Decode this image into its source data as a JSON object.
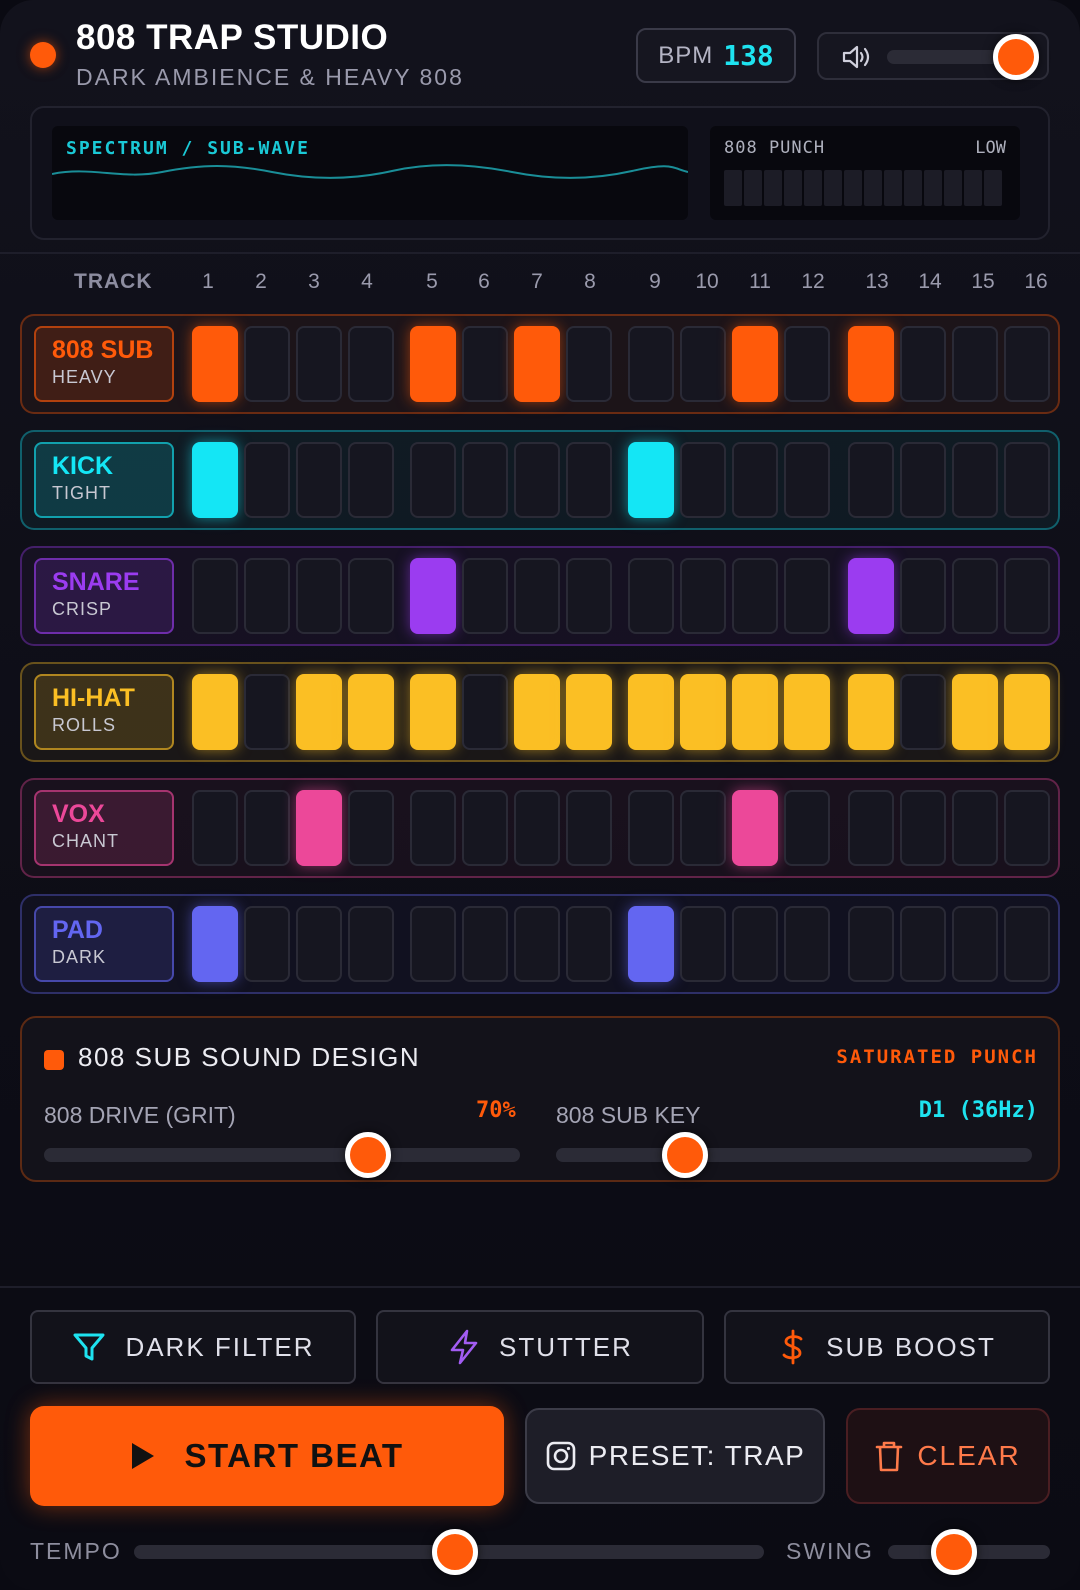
{
  "header": {
    "title": "808 TRAP STUDIO",
    "subtitle": "DARK AMBIENCE & HEAVY 808",
    "bpm_label": "BPM",
    "bpm_value": "138",
    "volume_level": 0.92
  },
  "displays": {
    "spectrum_label": "SPECTRUM / SUB-WAVE",
    "punch_label": "808 PUNCH",
    "punch_level": "LOW",
    "punch_meter_segments": 14
  },
  "sequencer": {
    "track_header": "TRACK",
    "steps": [
      "1",
      "2",
      "3",
      "4",
      "5",
      "6",
      "7",
      "8",
      "9",
      "10",
      "11",
      "12",
      "13",
      "14",
      "15",
      "16"
    ],
    "tracks": [
      {
        "name": "808 SUB",
        "sub": "HEAVY",
        "color": "#ff5a0a",
        "pattern": [
          1,
          0,
          0,
          0,
          1,
          0,
          1,
          0,
          0,
          0,
          1,
          0,
          1,
          0,
          0,
          0
        ]
      },
      {
        "name": "KICK",
        "sub": "TIGHT",
        "color": "#14e6f5",
        "pattern": [
          1,
          0,
          0,
          0,
          0,
          0,
          0,
          0,
          1,
          0,
          0,
          0,
          0,
          0,
          0,
          0
        ]
      },
      {
        "name": "SNARE",
        "sub": "CRISP",
        "color": "#9b3cf0",
        "pattern": [
          0,
          0,
          0,
          0,
          1,
          0,
          0,
          0,
          0,
          0,
          0,
          0,
          1,
          0,
          0,
          0
        ]
      },
      {
        "name": "HI-HAT",
        "sub": "ROLLS",
        "color": "#fbbf24",
        "pattern": [
          1,
          0,
          1,
          1,
          1,
          0,
          1,
          1,
          1,
          1,
          1,
          1,
          1,
          0,
          1,
          1
        ]
      },
      {
        "name": "VOX",
        "sub": "CHANT",
        "color": "#ec4899",
        "pattern": [
          0,
          0,
          1,
          0,
          0,
          0,
          0,
          0,
          0,
          0,
          1,
          0,
          0,
          0,
          0,
          0
        ]
      },
      {
        "name": "PAD",
        "sub": "DARK",
        "color": "#6366f1",
        "pattern": [
          1,
          0,
          0,
          0,
          0,
          0,
          0,
          0,
          1,
          0,
          0,
          0,
          0,
          0,
          0,
          0
        ]
      }
    ]
  },
  "sound_design": {
    "title": "808 SUB SOUND DESIGN",
    "tag": "SATURATED PUNCH",
    "drive_label": "808 DRIVE (GRIT)",
    "drive_value": "70%",
    "drive_level": 0.68,
    "key_label": "808 SUB KEY",
    "key_value": "D1 (36Hz)",
    "key_level": 0.27
  },
  "fx": {
    "filter_label": "DARK FILTER",
    "stutter_label": "STUTTER",
    "boost_label": "SUB BOOST"
  },
  "actions": {
    "start_label": "START BEAT",
    "preset_label": "PRESET: TRAP",
    "clear_label": "CLEAR"
  },
  "footer": {
    "tempo_label": "TEMPO",
    "tempo_level": 0.51,
    "swing_label": "SWING",
    "swing_level": 0.41
  },
  "colors": {
    "accent": "#ff5a0a",
    "cyan": "#1ee3f0"
  }
}
